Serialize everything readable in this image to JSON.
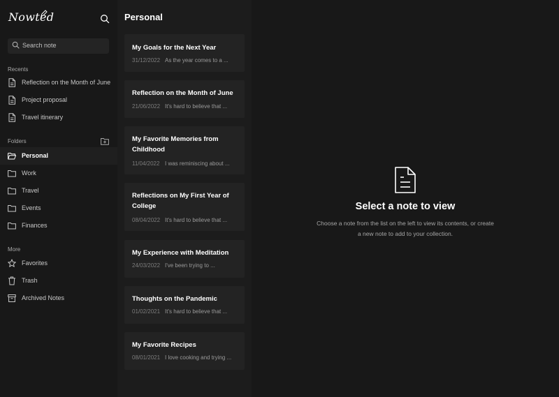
{
  "app": {
    "brand": "Nowted"
  },
  "search": {
    "placeholder": "Search note"
  },
  "recents": {
    "title": "Recents",
    "items": [
      {
        "label": "Reflection on the Month of June"
      },
      {
        "label": "Project proposal"
      },
      {
        "label": "Travel itinerary"
      }
    ]
  },
  "folders": {
    "title": "Folders",
    "items": [
      {
        "label": "Personal",
        "active": true
      },
      {
        "label": "Work"
      },
      {
        "label": "Travel"
      },
      {
        "label": "Events"
      },
      {
        "label": "Finances"
      }
    ]
  },
  "more": {
    "title": "More",
    "items": [
      {
        "label": "Favorites",
        "icon": "star-icon"
      },
      {
        "label": "Trash",
        "icon": "trash-icon"
      },
      {
        "label": "Archived Notes",
        "icon": "archive-icon"
      }
    ]
  },
  "list": {
    "title": "Personal",
    "notes": [
      {
        "title": "My Goals for the Next Year",
        "date": "31/12/2022",
        "preview": "As the year comes to a ..."
      },
      {
        "title": "Reflection on the Month of June",
        "date": "21/06/2022",
        "preview": "It's hard to believe that ..."
      },
      {
        "title": "My Favorite Memories from Childhood",
        "date": "11/04/2022",
        "preview": "I was reminiscing about ..."
      },
      {
        "title": "Reflections on My First Year of College",
        "date": "08/04/2022",
        "preview": "It's hard to believe that ..."
      },
      {
        "title": "My Experience with Meditation",
        "date": "24/03/2022",
        "preview": "I've been trying to ..."
      },
      {
        "title": "Thoughts on the Pandemic",
        "date": "01/02/2021",
        "preview": "It's hard to believe that ..."
      },
      {
        "title": "My Favorite Recipes",
        "date": "08/01/2021",
        "preview": "I love cooking and trying ..."
      }
    ]
  },
  "empty_state": {
    "title": "Select a note to view",
    "subtitle": "Choose a note from the list on the left to view its contents, or create a new note to add to your collection."
  }
}
